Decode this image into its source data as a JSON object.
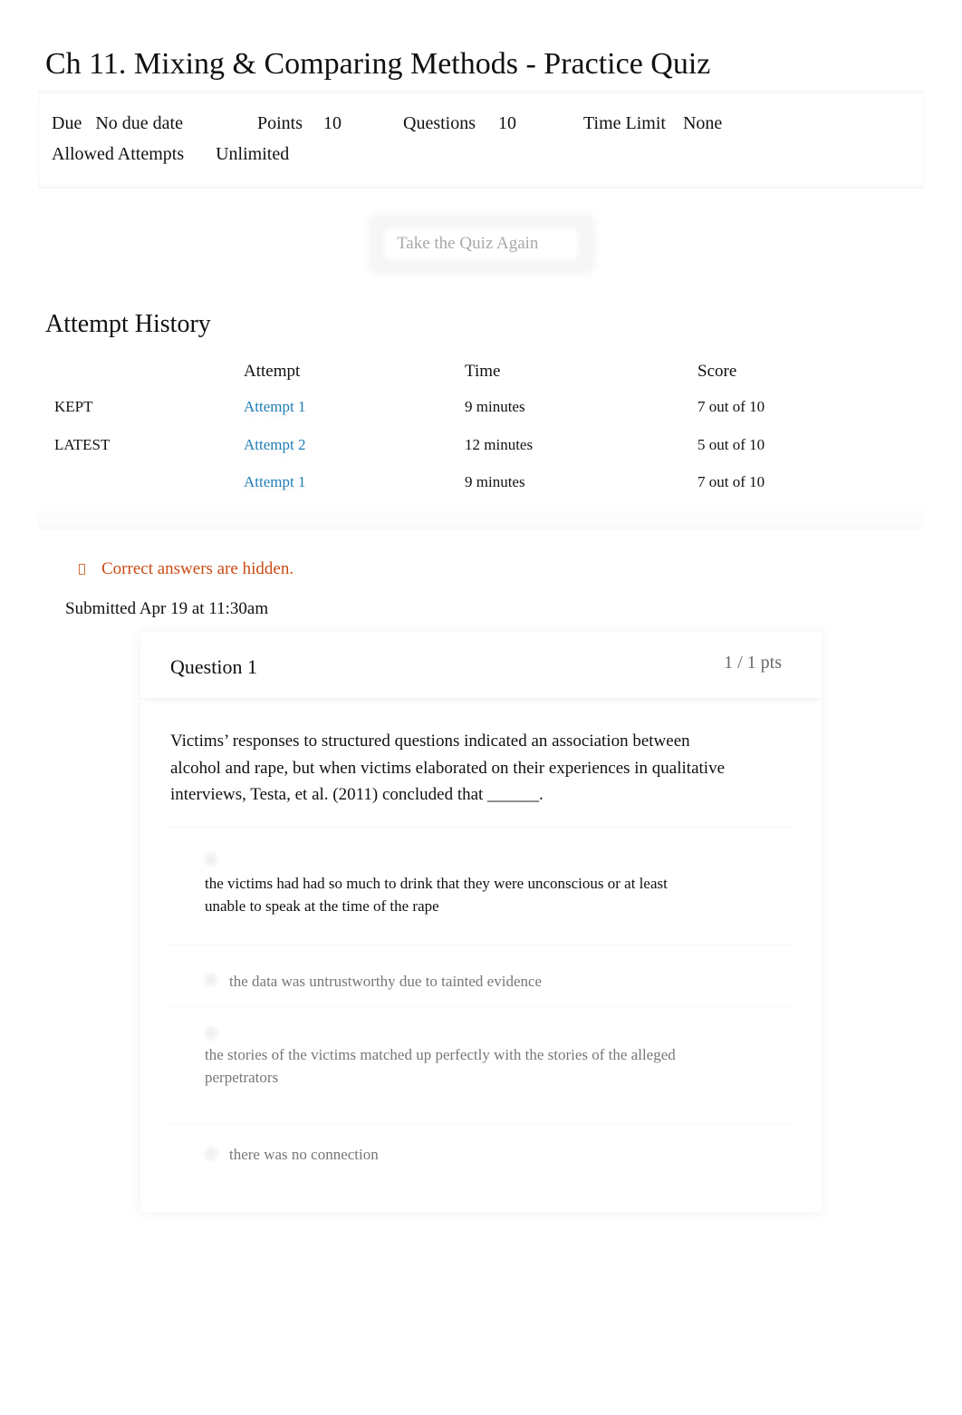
{
  "page": {
    "title": "Ch 11. Mixing & Comparing Methods - Practice Quiz"
  },
  "meta": {
    "due_label": "Due",
    "due_value": "No due date",
    "points_label": "Points",
    "points_value": "10",
    "questions_label": "Questions",
    "questions_value": "10",
    "time_limit_label": "Time Limit",
    "time_limit_value": "None",
    "allowed_attempts_label": "Allowed Attempts",
    "allowed_attempts_value": "Unlimited"
  },
  "actions": {
    "take_quiz_again": "Take the Quiz Again"
  },
  "attempt_history": {
    "title": "Attempt History",
    "columns": [
      "",
      "Attempt",
      "Time",
      "Score"
    ],
    "rows": [
      {
        "status": "KEPT",
        "attempt": "Attempt 1",
        "time": "9 minutes",
        "score": "7 out of 10"
      },
      {
        "status": "LATEST",
        "attempt": "Attempt 2",
        "time": "12 minutes",
        "score": "5 out of 10"
      },
      {
        "status": "",
        "attempt": "Attempt 1",
        "time": "9 minutes",
        "score": "7 out of 10"
      }
    ]
  },
  "notice": {
    "icon": "info-icon",
    "text": "Correct answers are hidden.",
    "color": "#cb4a14"
  },
  "submission": {
    "text": "Submitted Apr 19 at 11:30am"
  },
  "question": {
    "name": "Question 1",
    "points": "1 / 1 pts",
    "text": "Victims’ responses to structured questions indicated an association between alcohol and rape, but when victims elaborated on their experiences in qualitative interviews, Testa, et al. (2011) concluded that ______.",
    "answers": [
      {
        "text": "the victims had had so much to drink that they were unconscious or at least unable to speak at the time of the rape",
        "selected": true
      },
      {
        "text": "the data was untrustworthy due to tainted evidence",
        "selected": false
      },
      {
        "text": "the stories of the victims matched up perfectly with the stories of the alleged perpetrators",
        "selected": false
      },
      {
        "text": "there was no connection",
        "selected": false
      }
    ]
  },
  "colors": {
    "link": "#1f7eb8",
    "muted_text": "#777777",
    "button_text": "#a9a9a9"
  }
}
